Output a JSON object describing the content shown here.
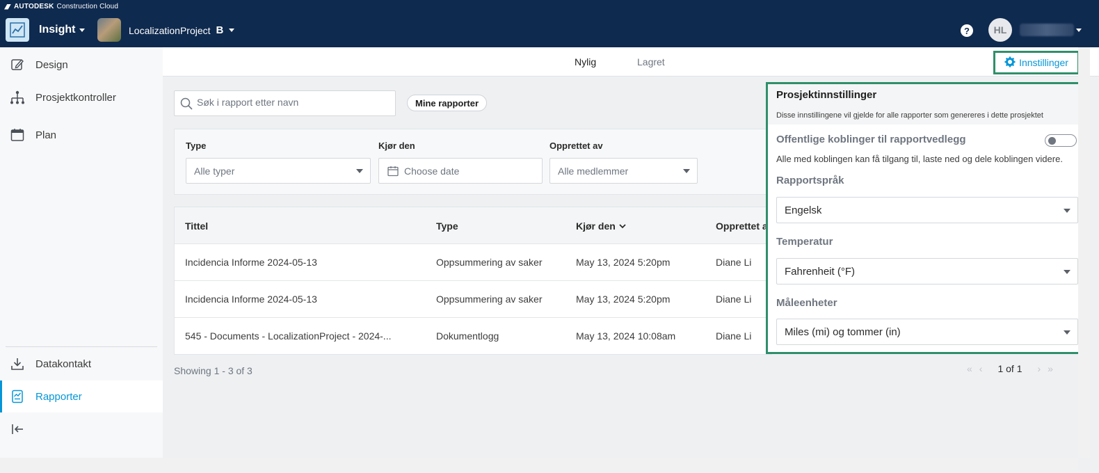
{
  "brand": {
    "name": "AUTODESK",
    "product": "Construction Cloud"
  },
  "header": {
    "app_label": "Insight",
    "project_name": "LocalizationProject",
    "project_badge": "B",
    "avatar_initials": "HL"
  },
  "sidebar": {
    "items": [
      {
        "label": "Design",
        "icon": "pencil-square-icon"
      },
      {
        "label": "Prosjektkontroller",
        "icon": "hierarchy-icon"
      },
      {
        "label": "Plan",
        "icon": "calendar-icon"
      },
      {
        "label": "Datakontakt",
        "icon": "download-icon"
      },
      {
        "label": "Rapporter",
        "icon": "report-icon"
      }
    ],
    "active": "Rapporter"
  },
  "tabs": [
    {
      "label": "Nylig"
    },
    {
      "label": "Lagret"
    }
  ],
  "settings_link": "Innstillinger",
  "search": {
    "placeholder": "Søk i rapport etter navn"
  },
  "chip": "Mine rapporter",
  "filters": {
    "type": {
      "label": "Type",
      "placeholder": "Alle typer"
    },
    "date": {
      "label": "Kjør den",
      "placeholder": "Choose date"
    },
    "creator": {
      "label": "Opprettet av",
      "placeholder": "Alle medlemmer"
    }
  },
  "table": {
    "columns": [
      "Tittel",
      "Type",
      "Kjør den",
      "Opprettet a"
    ],
    "rows": [
      [
        "Incidencia Informe 2024-05-13",
        "Oppsummering av saker",
        "May 13, 2024 5:20pm",
        "Diane Li"
      ],
      [
        "Incidencia Informe 2024-05-13",
        "Oppsummering av saker",
        "May 13, 2024 5:20pm",
        "Diane Li"
      ],
      [
        "545 - Documents - LocalizationProject - 2024-...",
        "Dokumentlogg",
        "May 13, 2024 10:08am",
        "Diane Li"
      ]
    ]
  },
  "showing": "Showing 1 - 3 of 3",
  "pagination": "1 of 1",
  "panel": {
    "title": "Prosjektinnstillinger",
    "description": "Disse innstillingene vil gjelde for alle rapporter som genereres i dette prosjektet",
    "public_links_label": "Offentlige koblinger til rapportvedlegg",
    "public_links_help": "Alle med koblingen kan få tilgang til, laste ned og dele koblingen videre.",
    "public_links_enabled": false,
    "language_label": "Rapportspråk",
    "language_value": "Engelsk",
    "temperature_label": "Temperatur",
    "temperature_value": "Fahrenheit (°F)",
    "units_label": "Måleenheter",
    "units_value": "Miles (mi) og tommer (in)"
  },
  "colors": {
    "header_bg": "#0f2a4f",
    "accent": "#0696d7",
    "highlight_border": "#2f8f6a"
  }
}
